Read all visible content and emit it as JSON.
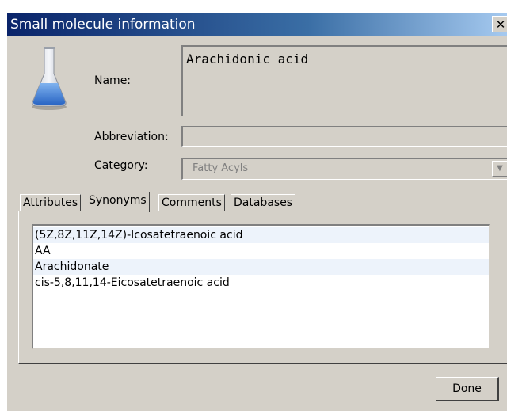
{
  "window": {
    "title": "Small molecule information",
    "close_label": "✕"
  },
  "form": {
    "name_label": "Name:",
    "name_value": "Arachidonic acid",
    "abbreviation_label": "Abbreviation:",
    "abbreviation_value": "",
    "category_label": "Category:",
    "category_value": "Fatty Acyls"
  },
  "tabs": [
    {
      "label": "Attributes",
      "active": false
    },
    {
      "label": "Synonyms",
      "active": true
    },
    {
      "label": "Comments",
      "active": false
    },
    {
      "label": "Databases",
      "active": false
    }
  ],
  "synonyms": [
    "(5Z,8Z,11Z,14Z)-Icosatetraenoic acid",
    "AA",
    "Arachidonate",
    "cis-5,8,11,14-Eicosatetraenoic acid"
  ],
  "buttons": {
    "done_label": "Done"
  },
  "icons": {
    "app_icon": "flask-icon",
    "dropdown": "chevron-down-icon"
  },
  "colors": {
    "titlebar_start": "#0a246a",
    "dialog_bg": "#d4d0c8",
    "flask_liquid": "#3a7bd5"
  }
}
